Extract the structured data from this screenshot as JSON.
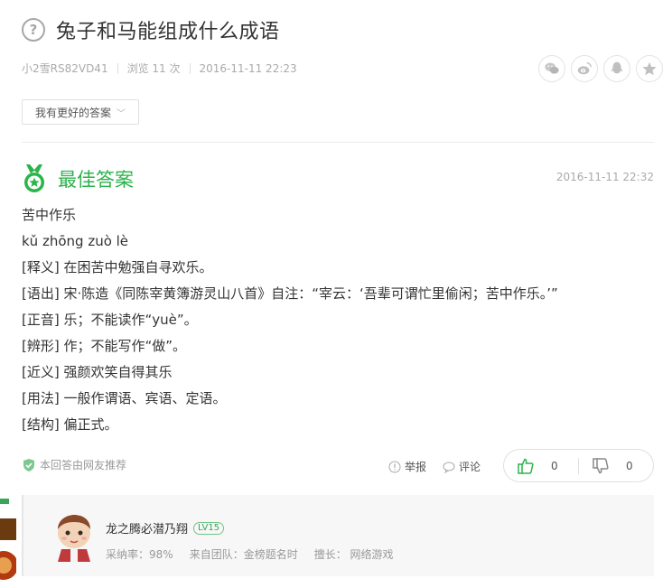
{
  "question": {
    "title": "兔子和马能组成什么成语",
    "icon": "question-circle-icon"
  },
  "meta": {
    "user": "小2雪RS82VD41",
    "views": "浏览 11 次",
    "date": "2016-11-11 22:23"
  },
  "share": [
    "wechat-icon",
    "weibo-icon",
    "qq-icon",
    "qzone-icon"
  ],
  "better_answer_button": "我有更好的答案",
  "best_answer": {
    "title": "最佳答案",
    "date": "2016-11-11 22:32",
    "lines": [
      "苦中作乐",
      "kǔ   zhōng   zuò   lè",
      "[释义]  在困苦中勉强自寻欢乐。",
      "[语出]  宋·陈造《同陈宰黄簿游灵山八首》自注：“宰云：‘吾辈可谓忙里偷闲；苦中作乐。’”",
      "[正音]  乐；不能读作“yuè”。",
      "[辨形]  作；不能写作“做”。",
      "[近义]   强颜欢笑自得其乐",
      "[用法]  一般作谓语、宾语、定语。",
      "[结构]  偏正式。"
    ]
  },
  "recommend_text": "本回答由网友推荐",
  "actions": {
    "report": "举报",
    "comment": "评论"
  },
  "votes": {
    "up": "0",
    "down": "0"
  },
  "answerer": {
    "name": "龙之腾必潜乃翔",
    "level": "LV15",
    "adoption_rate": "采纳率：98%",
    "team": "来自团队：金榜题名时",
    "specialty": "擅长：  网络游戏"
  },
  "colors": {
    "accent_green": "#2bb34c",
    "text_main": "#333333",
    "text_muted": "#aaaaaa"
  }
}
